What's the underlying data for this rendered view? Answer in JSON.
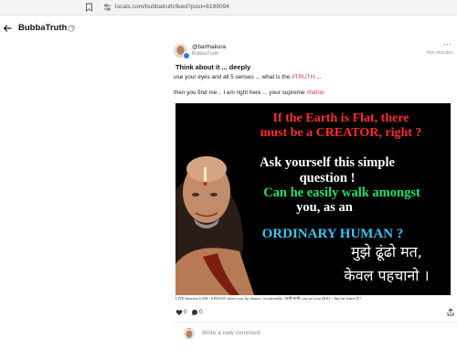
{
  "browser": {
    "url": "locals.com/bubbatruth/feed?post=8199094"
  },
  "header": {
    "title": "BubbaTruth"
  },
  "post": {
    "author_handle": "@barthakura",
    "community": "BubbaTruth",
    "timestamp": "five minutes",
    "title": "Think about it ... deeply",
    "line1_prefix": "use your eyes and all 5 senses ... what is the ",
    "line1_tag": "#TRUTH",
    "line1_suffix": " ...",
    "line2_prefix": "then you find me .. I am right here ... your supreme ",
    "line2_tag": "#father",
    "image": {
      "headline1": "If the Earth is Flat, there",
      "headline2": "must be a CREATOR, right ?",
      "q1": "Ask yourself this simple",
      "q2": "question !",
      "q3": "Can he easily walk amongst",
      "q4": "you,  as an",
      "q5": "ORDINARY HUMAN  ?",
      "hindi1": "मुझे ढूंढो मत,",
      "hindi2": "केवल पहचानो ।",
      "caption": "LIVE between 6 AM - 6 PM IST where you, by chance / occasionally / कभी-कभी, can see your DOG ~ flip the letters D !",
      "headline_color": "#ff2b2b",
      "white_color": "#ffffff",
      "green_color": "#22e06a",
      "cyan_color": "#39c5f2"
    },
    "likes": "0",
    "comments": "0"
  },
  "comment_box": {
    "placeholder": "Write a new comment"
  }
}
